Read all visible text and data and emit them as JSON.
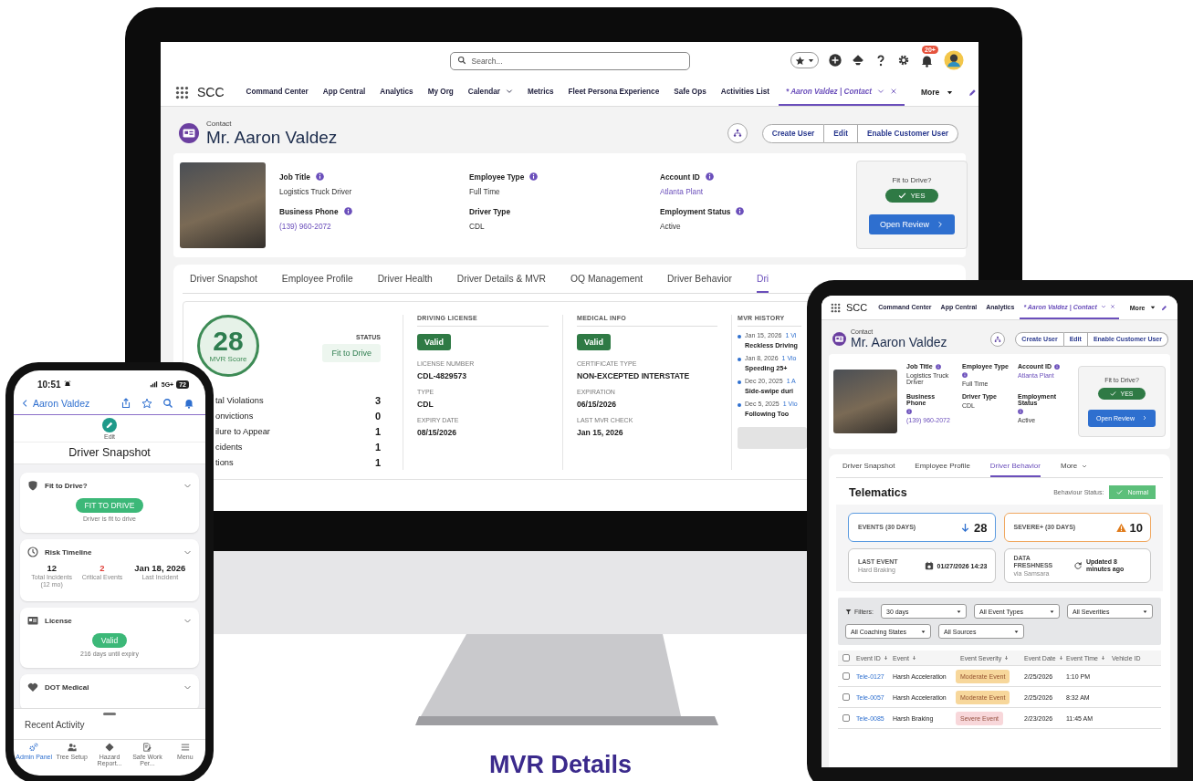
{
  "monitor": {
    "search": {
      "placeholder": "Search..."
    },
    "notifications": "20+",
    "nav": {
      "app": "SCC",
      "more": "More",
      "items": [
        {
          "label": "Command Center",
          "selected": false,
          "dropdown": false,
          "closable": false
        },
        {
          "label": "App Central",
          "selected": false,
          "dropdown": false,
          "closable": false
        },
        {
          "label": "Analytics",
          "selected": false,
          "dropdown": false,
          "closable": false
        },
        {
          "label": "My Org",
          "selected": false,
          "dropdown": false,
          "closable": false
        },
        {
          "label": "Calendar",
          "selected": false,
          "dropdown": true,
          "closable": false
        },
        {
          "label": "Metrics",
          "selected": false,
          "dropdown": false,
          "closable": false
        },
        {
          "label": "Fleet Persona Experience",
          "selected": false,
          "dropdown": false,
          "closable": false
        },
        {
          "label": "Safe Ops",
          "selected": false,
          "dropdown": false,
          "closable": false
        },
        {
          "label": "Activities List",
          "selected": false,
          "dropdown": false,
          "closable": false
        },
        {
          "label": "* Aaron Valdez | Contact",
          "selected": true,
          "dropdown": true,
          "closable": true
        }
      ]
    },
    "record": {
      "type": "Contact",
      "name": "Mr. Aaron Valdez",
      "actions": [
        "Create User",
        "Edit",
        "Enable Customer User"
      ]
    },
    "fields": [
      {
        "label": "Job Title",
        "value": "Logistics Truck Driver",
        "info": true,
        "link": false
      },
      {
        "label": "Employee Type",
        "value": "Full Time",
        "info": true,
        "link": false
      },
      {
        "label": "Account ID",
        "value": "Atlanta Plant",
        "info": true,
        "link": true
      },
      {
        "label": "Business Phone",
        "value": "(139) 960-2072",
        "info": true,
        "link": true
      },
      {
        "label": "Driver Type",
        "value": "CDL",
        "info": false,
        "link": false
      },
      {
        "label": "Employment Status",
        "value": "Active",
        "info": true,
        "link": false
      }
    ],
    "fit": {
      "label": "Fit to Drive?",
      "status": "YES",
      "action": "Open Review"
    },
    "tabs": [
      {
        "label": "Driver Snapshot",
        "selected": false,
        "dropdown": false
      },
      {
        "label": "Employee Profile",
        "selected": false,
        "dropdown": false
      },
      {
        "label": "Driver Health",
        "selected": false,
        "dropdown": false
      },
      {
        "label": "Driver Details & MVR",
        "selected": false,
        "dropdown": false
      },
      {
        "label": "OQ Management",
        "selected": false,
        "dropdown": false
      },
      {
        "label": "Driver Behavior",
        "selected": false,
        "dropdown": false
      },
      {
        "label": "Dri",
        "selected": true,
        "dropdown": false
      }
    ],
    "score": {
      "value": "28",
      "label": "MVR Score",
      "status_label": "STATUS",
      "status": "Fit to Drive"
    },
    "counts": [
      {
        "label": "tal Violations",
        "value": "3"
      },
      {
        "label": "onvictions",
        "value": "0"
      },
      {
        "label": "ilure to Appear",
        "value": "1"
      },
      {
        "label": "cidents",
        "value": "1"
      },
      {
        "label": "tions",
        "value": "1"
      }
    ],
    "sections": [
      {
        "title": "DRIVING LICENSE",
        "badge": "Valid",
        "fields": [
          {
            "label": "LICENSE NUMBER",
            "value": "CDL-4829573"
          },
          {
            "label": "TYPE",
            "value": "CDL"
          },
          {
            "label": "EXPIRY DATE",
            "value": "08/15/2026"
          }
        ]
      },
      {
        "title": "MEDICAL INFO",
        "badge": "Valid",
        "fields": [
          {
            "label": "CERTIFICATE TYPE",
            "value": "NON-EXCEPTED INTERSTATE"
          },
          {
            "label": "EXPIRATION",
            "value": "06/15/2026"
          },
          {
            "label": "LAST MVR CHECK",
            "value": "Jan 15, 2026"
          }
        ]
      }
    ],
    "history": {
      "title": "MVR HISTORY",
      "items": [
        {
          "date": "Jan 15, 2026",
          "count": "1 Vi",
          "event": "Reckless Driving"
        },
        {
          "date": "Jan 8, 2026",
          "count": "1 Vio",
          "event": "Speeding 25+"
        },
        {
          "date": "Dec 20, 2025",
          "count": "1 A",
          "event": "Side-swipe duri"
        },
        {
          "date": "Dec 5, 2025",
          "count": "1 Vio",
          "event": "Following Too"
        }
      ]
    }
  },
  "phone": {
    "status": {
      "time": "10:51",
      "network": "5G+",
      "battery": "72"
    },
    "back": "Aaron Valdez",
    "edit": "Edit",
    "title": "Driver Snapshot",
    "cards": [
      {
        "kind": "status",
        "title": "Fit to Drive?",
        "badge": "FIT TO DRIVE",
        "note": "Driver is fit to drive"
      },
      {
        "kind": "stats",
        "title": "Risk Timeline",
        "stats": [
          {
            "value": "12",
            "label": "Total Incidents (12 mo)",
            "critical": false
          },
          {
            "value": "2",
            "label": "Critical Events",
            "critical": true
          },
          {
            "value": "Jan 18, 2026",
            "label": "Last Incident",
            "critical": false
          }
        ]
      },
      {
        "kind": "status",
        "title": "License",
        "badge": "Valid",
        "note": "216 days until expiry"
      },
      {
        "kind": "collapsed",
        "title": "DOT Medical"
      }
    ],
    "sheet": "Recent Activity",
    "tabbar": [
      {
        "label": "Admin Panel",
        "selected": true
      },
      {
        "label": "Tree Setup",
        "selected": false
      },
      {
        "label": "Hazard Report...",
        "selected": false
      },
      {
        "label": "Safe Work Per...",
        "selected": false
      },
      {
        "label": "Menu",
        "selected": false
      }
    ]
  },
  "tablet": {
    "nav": {
      "app": "SCC",
      "more": "More",
      "items": [
        {
          "label": "Command Center",
          "selected": false,
          "dropdown": false,
          "closable": false
        },
        {
          "label": "App Central",
          "selected": false,
          "dropdown": false,
          "closable": false
        },
        {
          "label": "Analytics",
          "selected": false,
          "dropdown": false,
          "closable": false
        },
        {
          "label": "* Aaron Valdez | Contact",
          "selected": true,
          "dropdown": true,
          "closable": true
        }
      ]
    },
    "record": {
      "type": "Contact",
      "name": "Mr. Aaron Valdez",
      "actions": [
        "Create User",
        "Edit",
        "Enable Customer User"
      ]
    },
    "fields": [
      {
        "label": "Job Title",
        "value": "Logistics Truck Driver",
        "info": true,
        "link": false
      },
      {
        "label": "Employee Type",
        "value": "Full Time",
        "info": true,
        "link": false
      },
      {
        "label": "Account ID",
        "value": "Atlanta Plant",
        "info": true,
        "link": true
      },
      {
        "label": "Business Phone",
        "value": "(139) 960-2072",
        "info": true,
        "link": true
      },
      {
        "label": "Driver Type",
        "value": "CDL",
        "info": false,
        "link": false
      },
      {
        "label": "Employment Status",
        "value": "Active",
        "info": true,
        "link": false
      }
    ],
    "fit": {
      "label": "Fit to Drive?",
      "status": "YES",
      "action": "Open Review"
    },
    "tabs": [
      {
        "label": "Driver Snapshot",
        "selected": false,
        "dropdown": false
      },
      {
        "label": "Employee Profile",
        "selected": false,
        "dropdown": false
      },
      {
        "label": "Driver Behavior",
        "selected": true,
        "dropdown": false
      },
      {
        "label": "More",
        "selected": false,
        "dropdown": true
      }
    ],
    "telematics": {
      "title": "Telematics",
      "status_label": "Behaviour Status:",
      "status": "Normal"
    },
    "metrics": [
      {
        "kind": "trend",
        "label": "EVENTS (30 DAYS)",
        "value": "28"
      },
      {
        "kind": "alert",
        "label": "SEVERE+ (30 DAYS)",
        "value": "10"
      },
      {
        "kind": "timestamp",
        "label": "LAST EVENT",
        "sub": "Hard Braking",
        "value": "01/27/2026 14:23"
      },
      {
        "kind": "sync",
        "label": "DATA FRESHNESS",
        "sub": "via Samsara",
        "value": "Updated 8 minutes ago"
      }
    ],
    "filters": {
      "label": "Filters:",
      "selects": [
        "30 days",
        "All Event Types",
        "All Severities",
        "All Coaching States",
        "All Sources"
      ]
    },
    "table": {
      "select_all_checked": false,
      "columns": [
        {
          "label": "Event ID",
          "sortable": true
        },
        {
          "label": "Event",
          "sortable": true
        },
        {
          "label": "Event Severity",
          "sortable": true
        },
        {
          "label": "Event Date",
          "sortable": true
        },
        {
          "label": "Event Time",
          "sortable": true
        },
        {
          "label": "Vehicle ID",
          "sortable": false
        }
      ],
      "rows": [
        {
          "checked": false,
          "id": "Tele-0127",
          "event": "Harsh Acceleration",
          "color": "#f7d79b",
          "severity_label": "Moderate Event",
          "date": "2/25/2026",
          "time": "1:10 PM"
        },
        {
          "checked": false,
          "id": "Tele-0057",
          "event": "Harsh Acceleration",
          "color": "#f7d79b",
          "severity_label": "Moderate Event",
          "date": "2/25/2026",
          "time": "8:32 AM"
        },
        {
          "checked": false,
          "id": "Tele-0085",
          "event": "Harsh Braking",
          "color": "#f8d7da",
          "severity_label": "Severe Event",
          "date": "2/23/2026",
          "time": "11:45 AM"
        }
      ]
    }
  },
  "caption": "MVR Details"
}
